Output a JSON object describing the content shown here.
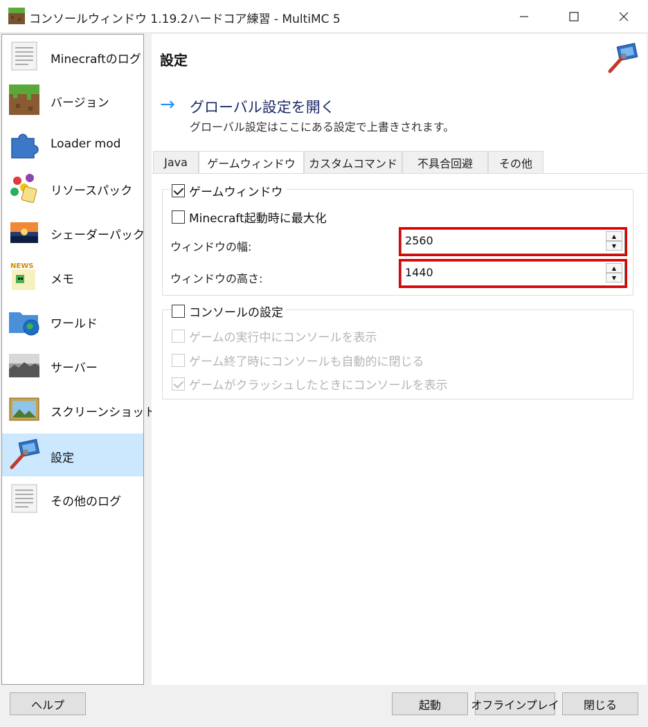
{
  "window": {
    "title": "コンソールウィンドウ 1.19.2ハードコア練習 - MultiMC 5",
    "minimize_glyph": "—",
    "maximize_glyph": "☐",
    "close_glyph": "✕"
  },
  "sidebar": {
    "items": [
      {
        "label": "Minecraftのログ",
        "icon": "log-document-icon"
      },
      {
        "label": "バージョン",
        "icon": "grass-block-icon"
      },
      {
        "label": "Loader mod",
        "icon": "puzzle-piece-icon"
      },
      {
        "label": "リソースパック",
        "icon": "resource-pack-icon"
      },
      {
        "label": "シェーダーパック",
        "icon": "shader-pack-icon"
      },
      {
        "label": "メモ",
        "icon": "news-note-icon"
      },
      {
        "label": "ワールド",
        "icon": "world-folder-icon"
      },
      {
        "label": "サーバー",
        "icon": "server-icon"
      },
      {
        "label": "スクリーンショット",
        "icon": "screenshot-picture-icon"
      },
      {
        "label": "設定",
        "icon": "settings-computer-icon",
        "selected": true
      },
      {
        "label": "その他のログ",
        "icon": "other-log-document-icon"
      }
    ]
  },
  "main": {
    "title": "設定",
    "global_link": {
      "title": "グローバル設定を開く",
      "description": "グローバル設定はここにある設定で上書きされます。"
    },
    "tabs": [
      {
        "label": "Java"
      },
      {
        "label": "ゲームウィンドウ",
        "active": true
      },
      {
        "label": "カスタムコマンド"
      },
      {
        "label": "不具合回避"
      },
      {
        "label": "その他"
      }
    ],
    "game_window": {
      "group_label": "ゲームウィンドウ",
      "group_checked": true,
      "maximize_label": "Minecraft起動時に最大化",
      "maximize_checked": false,
      "width_label": "ウィンドウの幅:",
      "width_value": "2560",
      "height_label": "ウィンドウの高さ:",
      "height_value": "1440"
    },
    "console": {
      "group_label": "コンソールの設定",
      "group_checked": false,
      "options": [
        {
          "label": "ゲームの実行中にコンソールを表示",
          "checked": false
        },
        {
          "label": "ゲーム終了時にコンソールも自動的に閉じる",
          "checked": false
        },
        {
          "label": "ゲームがクラッシュしたときにコンソールを表示",
          "checked": true
        }
      ]
    }
  },
  "footer": {
    "help": "ヘルプ",
    "launch": "起動",
    "offline": "オフラインプレイ",
    "close": "閉じる"
  },
  "colors": {
    "selection": "#cce8ff",
    "highlight_box": "#e00000",
    "link_arrow": "#1e90ff",
    "link_title": "#1b2a68"
  }
}
